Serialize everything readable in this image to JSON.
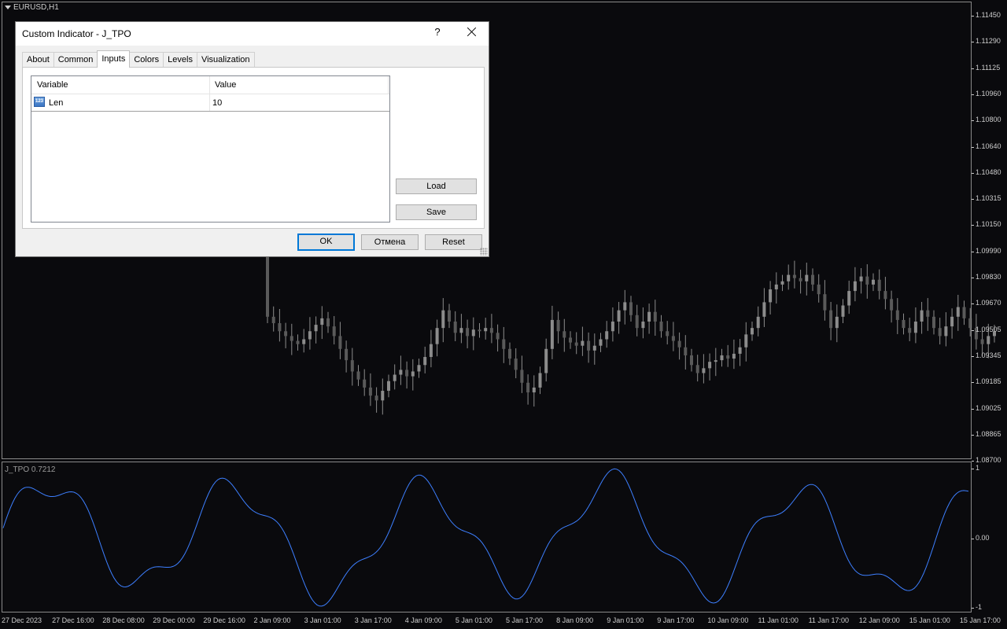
{
  "chart": {
    "symbol": "EURUSD,H1",
    "indicator_label": "J_TPO 0.7212",
    "price_ticks": [
      "1.11450",
      "1.11290",
      "1.11125",
      "1.10960",
      "1.10800",
      "1.10640",
      "1.10480",
      "1.10315",
      "1.10150",
      "1.09990",
      "1.09830",
      "1.09670",
      "1.09505",
      "1.09345",
      "1.09185",
      "1.09025",
      "1.08865",
      "1.08700"
    ],
    "indicator_ticks": [
      "1",
      "0.00",
      "-1"
    ],
    "time_ticks": [
      "27 Dec 2023",
      "27 Dec 16:00",
      "28 Dec 08:00",
      "29 Dec 00:00",
      "29 Dec 16:00",
      "2 Jan 09:00",
      "3 Jan 01:00",
      "3 Jan 17:00",
      "4 Jan 09:00",
      "5 Jan 01:00",
      "5 Jan 17:00",
      "8 Jan 09:00",
      "9 Jan 01:00",
      "9 Jan 17:00",
      "10 Jan 09:00",
      "11 Jan 01:00",
      "11 Jan 17:00",
      "12 Jan 09:00",
      "15 Jan 01:00",
      "15 Jan 17:00"
    ],
    "colors": {
      "background": "#0a0a0d",
      "candle": "#8c8c8c",
      "indicator_line": "#3d7fff",
      "grid_border": "#8a8a8a"
    },
    "closes": [
      1.0958,
      1.0954,
      1.0949,
      1.0946,
      1.0943,
      1.0941,
      1.0944,
      1.0949,
      1.0953,
      1.0957,
      1.0952,
      1.0946,
      1.0938,
      1.0931,
      1.0924,
      1.0919,
      1.0914,
      1.0909,
      1.0906,
      1.0912,
      1.0918,
      1.0922,
      1.0925,
      1.0921,
      1.0924,
      1.0928,
      1.0933,
      1.0941,
      1.0951,
      1.0962,
      1.0955,
      1.0948,
      1.0951,
      1.0946,
      1.095,
      1.0949,
      1.0951,
      1.0948,
      1.0944,
      1.0938,
      1.0932,
      1.0925,
      1.0917,
      1.0911,
      1.0914,
      1.0923,
      1.0938,
      1.0956,
      1.0949,
      1.0945,
      1.0942,
      1.094,
      1.0943,
      1.0937,
      1.094,
      1.0944,
      1.0949,
      1.0955,
      1.0962,
      1.0967,
      1.0959,
      1.0951,
      1.0955,
      1.0961,
      1.0955,
      1.0949,
      1.0946,
      1.0943,
      1.0939,
      1.0934,
      1.0928,
      1.0923,
      1.0926,
      1.093,
      1.0931,
      1.0934,
      1.0932,
      1.0935,
      1.0939,
      1.0947,
      1.0951,
      1.0958,
      1.0967,
      1.0975,
      1.0978,
      1.098,
      1.0984,
      1.0982,
      1.098,
      1.0984,
      1.0978,
      1.0972,
      1.0962,
      1.0951,
      1.0958,
      1.0965,
      1.0974,
      1.098,
      1.0983,
      1.0978,
      1.0981,
      1.0974,
      1.0969,
      1.0962,
      1.0956,
      1.0951,
      1.0948,
      1.0955,
      1.0962,
      1.0958,
      1.0951,
      1.0946,
      1.0952,
      1.0958,
      1.0964,
      1.0957,
      1.0951,
      1.0944,
      1.0941,
      1.0946,
      1.0949
    ]
  },
  "dialog": {
    "title": "Custom Indicator - J_TPO",
    "help": "?",
    "tabs": [
      "About",
      "Common",
      "Inputs",
      "Colors",
      "Levels",
      "Visualization"
    ],
    "active_tab": "Inputs",
    "columns": {
      "variable": "Variable",
      "value": "Value"
    },
    "params": [
      {
        "icon": "123",
        "name": "Len",
        "value": "10"
      }
    ],
    "buttons": {
      "load": "Load",
      "save": "Save",
      "ok": "OK",
      "cancel": "Отмена",
      "reset": "Reset"
    }
  }
}
